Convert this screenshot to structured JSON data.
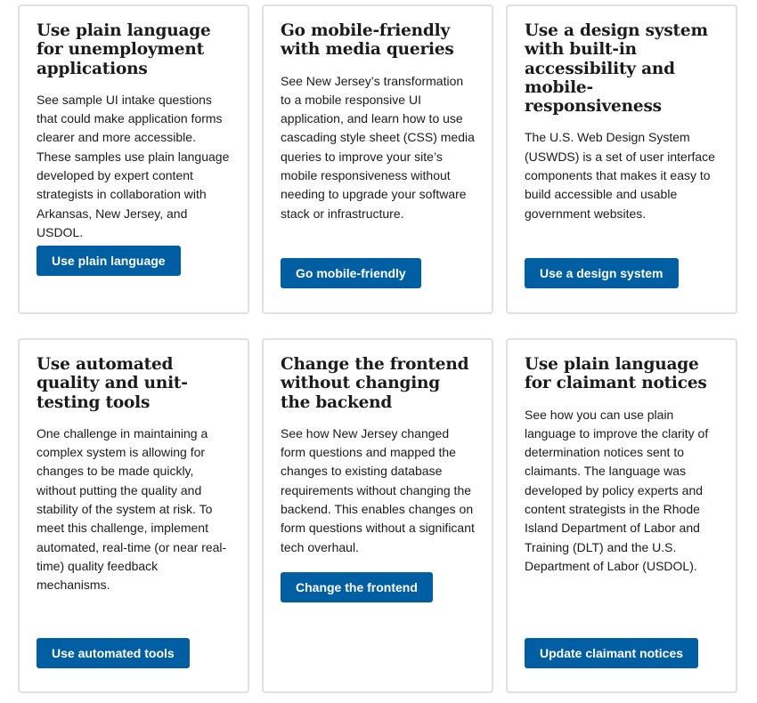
{
  "cards": [
    {
      "title": "Use plain language for unemployment applications",
      "description": "See sample UI intake questions that could make application forms clearer and more accessible. These samples use plain language developed by expert content strategists in collaboration with Arkansas, New Jersey, and USDOL.",
      "button_label": "Use plain language"
    },
    {
      "title": "Go mobile-friendly with media queries",
      "description": "See New Jersey’s transformation to a mobile responsive UI application, and learn how to use cascading style sheet (CSS) media queries to improve your site’s mobile responsiveness without needing to upgrade your software stack or infrastructure.",
      "button_label": "Go mobile-friendly"
    },
    {
      "title": "Use a design system with built-in accessibility and mobile-responsiveness",
      "description": "The U.S. Web Design System (USWDS) is a set of user interface components that makes it easy to build accessible and usable government websites.",
      "button_label": "Use a design system"
    },
    {
      "title": "Use automated quality and unit-testing tools",
      "description": "One challenge in maintaining a complex system is allowing for changes to be made quickly, without putting the quality and stability of the system at risk. To meet this challenge, implement automated, real-time (or near real-time) quality feedback mechanisms.",
      "button_label": "Use automated tools"
    },
    {
      "title": "Change the frontend without changing the backend",
      "description": "See how New Jersey changed form questions and mapped the changes to existing database requirements without changing the backend. This enables changes on form questions without a significant tech overhaul.",
      "button_label": "Change the frontend"
    },
    {
      "title": "Use plain language for claimant notices",
      "description": "See how you can use plain language to improve the clarity of determination notices sent to claimants. The language was developed by policy experts and content strategists in the Rhode Island Department of Labor and Training (DLT) and the U.S. Department of Labor (USDOL).",
      "button_label": "Update claimant notices"
    }
  ],
  "colors": {
    "button_bg": "#005ea2",
    "button_text": "#ffffff",
    "card_border": "#dfe1e2",
    "text": "#1b1b1b"
  }
}
